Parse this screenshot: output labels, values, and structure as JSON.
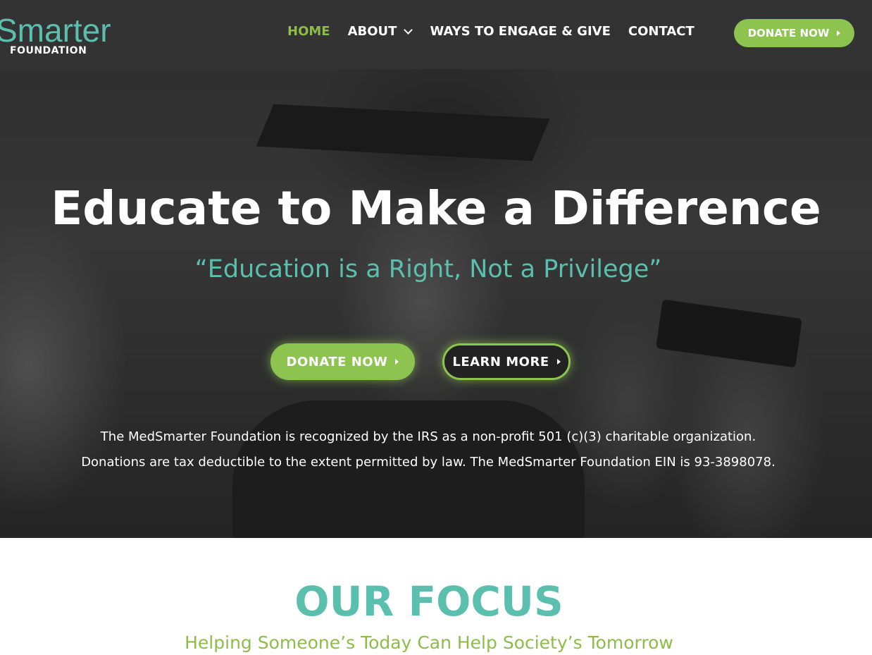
{
  "header": {
    "logo_main": "Smarter",
    "logo_sub": "FOUNDATION",
    "nav": {
      "home": "HOME",
      "about": "ABOUT",
      "ways": "WAYS TO ENGAGE & GIVE",
      "contact": "CONTACT"
    },
    "donate_label": "DONATE NOW"
  },
  "hero": {
    "title": "Educate to Make a Difference",
    "subtitle": "“Education is a Right, Not a Privilege”",
    "donate_label": "DONATE NOW",
    "learn_label": "LEARN MORE",
    "text_line1": "The MedSmarter Foundation is recognized by the IRS as a non-profit 501 (c)(3) charitable organization.",
    "text_line2": "Donations are tax deductible to the extent permitted by law. The MedSmarter Foundation EIN is 93-3898078."
  },
  "focus": {
    "title": "OUR FOCUS",
    "subtitle": "Helping Someone’s Today Can Help Society’s Tomorrow"
  },
  "colors": {
    "teal": "#5bbfae",
    "green": "#8dc450",
    "header_bg": "#333333"
  }
}
